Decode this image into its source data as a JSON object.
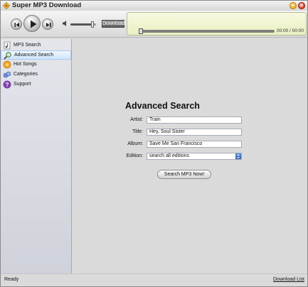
{
  "window": {
    "title": "Super MP3 Download"
  },
  "titlebar": {
    "minimize_glyph": "–",
    "close_glyph": "×"
  },
  "player": {
    "download_label": "Download",
    "time_readout": "00:00 / 00:00",
    "volume_level": 0.85,
    "progress": 0
  },
  "sidebar": {
    "items": [
      {
        "label": "MP3 Search",
        "icon": "mp3-file-icon"
      },
      {
        "label": "Advanced Search",
        "icon": "magnifier-icon",
        "active": true
      },
      {
        "label": "Hot Songs",
        "icon": "hot-songs-icon"
      },
      {
        "label": "Categories",
        "icon": "categories-icon"
      },
      {
        "label": "Support",
        "icon": "question-icon"
      }
    ]
  },
  "main": {
    "heading": "Advanced Search",
    "fields": {
      "artist": {
        "label": "Artist:",
        "value": "Train"
      },
      "title": {
        "label": "Title:",
        "value": "Hey, Soul Sister"
      },
      "album": {
        "label": "Album:",
        "value": "Save Me San Francisco"
      },
      "edition": {
        "label": "Edition:",
        "value": "search all editions"
      }
    },
    "search_button": "Search MP3 Now!"
  },
  "status": {
    "text": "Ready",
    "download_list": "Download List"
  },
  "colors": {
    "lcd_background": "#eef2cc",
    "active_nav": "#cfe5fb",
    "accent_blue": "#2a67c1"
  }
}
